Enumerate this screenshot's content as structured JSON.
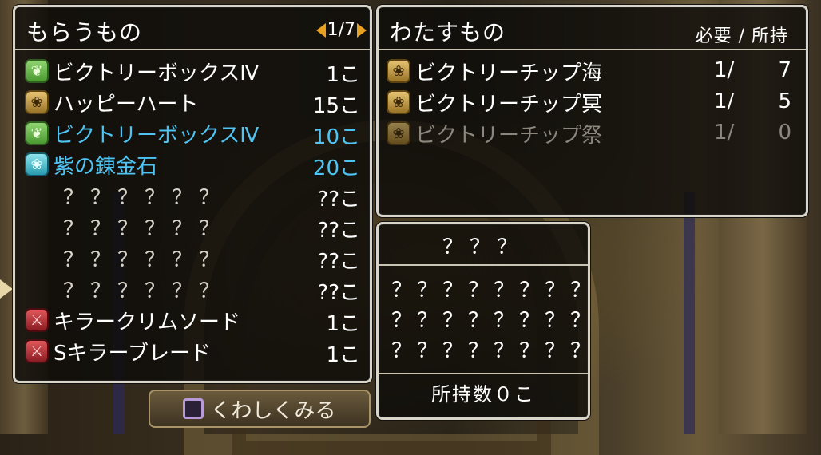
{
  "receive": {
    "title": "もらうもの",
    "page": "1/7",
    "items": [
      {
        "name": "ビクトリーボックスⅣ",
        "qty": "1こ",
        "icon": "leaf-green-icon",
        "style": "normal"
      },
      {
        "name": "ハッピーハート",
        "qty": "15こ",
        "icon": "gold-pouch-icon",
        "style": "normal"
      },
      {
        "name": "ビクトリーボックスⅣ",
        "qty": "10こ",
        "icon": "leaf-green-icon",
        "style": "highlight"
      },
      {
        "name": "紫の錬金石",
        "qty": "20こ",
        "icon": "cyan-pouch-icon",
        "style": "highlight"
      },
      {
        "name": "？？？？？？",
        "qty": "??こ",
        "icon": "",
        "style": "unknown"
      },
      {
        "name": "？？？？？？",
        "qty": "??こ",
        "icon": "",
        "style": "unknown"
      },
      {
        "name": "？？？？？？",
        "qty": "??こ",
        "icon": "",
        "style": "unknown"
      },
      {
        "name": "？？？？？？",
        "qty": "??こ",
        "icon": "",
        "style": "unknown"
      },
      {
        "name": "キラークリムソード",
        "qty": "1こ",
        "icon": "red-sword-icon",
        "style": "normal"
      },
      {
        "name": "Sキラーブレード",
        "qty": "1こ",
        "icon": "red-sword-icon",
        "style": "normal"
      }
    ]
  },
  "give": {
    "title": "わたすもの",
    "header": "必要 / 所持",
    "items": [
      {
        "name": "ビクトリーチップ海",
        "need": "1/",
        "have": "7",
        "style": "normal"
      },
      {
        "name": "ビクトリーチップ冥",
        "need": "1/",
        "have": "5",
        "style": "normal"
      },
      {
        "name": "ビクトリーチップ祭",
        "need": "1/",
        "have": "0",
        "style": "dim"
      }
    ]
  },
  "detail": {
    "title": "？？？",
    "lines": [
      "？？？？？？？？",
      "？？？？？？？？",
      "？？？？？？？？"
    ],
    "owned": "所持数０こ"
  },
  "detail_button": {
    "label": "くわしくみる",
    "icon": "square-button-icon"
  },
  "colors": {
    "highlight": "#4fc4f2",
    "dim": "#8b877e",
    "pager_arrow": "#e8a020"
  }
}
